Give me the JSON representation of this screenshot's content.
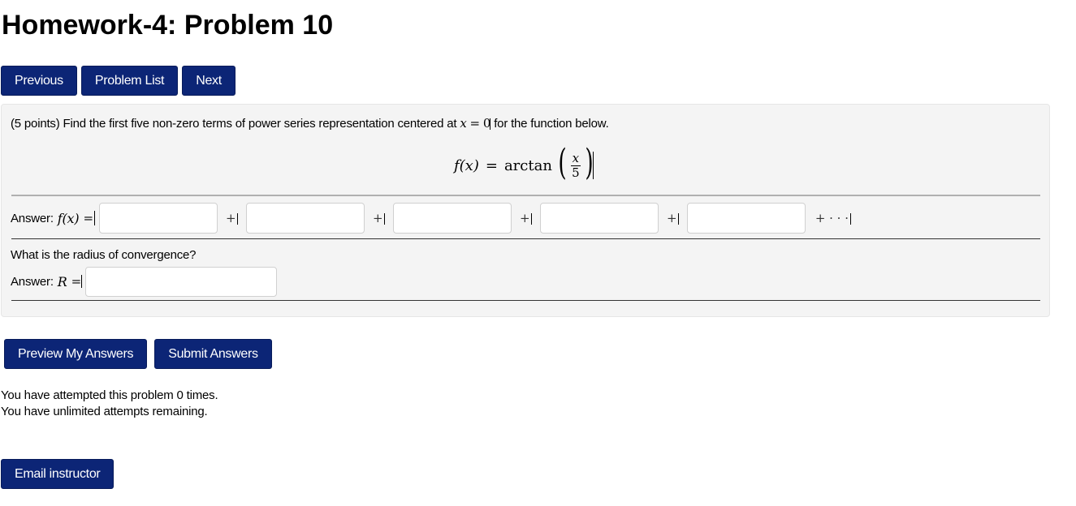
{
  "page": {
    "title": "Homework-4: Problem 10"
  },
  "nav": {
    "previous": "Previous",
    "problem_list": "Problem List",
    "next": "Next"
  },
  "problem": {
    "points": "(5 points)",
    "statement_before": "Find the first five non-zero terms of power series representation centered at",
    "center_var": "x",
    "center_eq": "=",
    "center_val": "0",
    "statement_after": "for the function below.",
    "formula": {
      "lhs": "f(x)",
      "eq": "=",
      "func": "arctan",
      "numerator": "x",
      "denominator": "5"
    },
    "answer_label": "Answer:",
    "answer_lhs": "f(x)",
    "answer_eq": "=",
    "plus": "+",
    "tail": "+ · · ·",
    "term_values": [
      "",
      "",
      "",
      "",
      ""
    ],
    "radius_question": "What is the radius of convergence?",
    "radius_label": "Answer:",
    "radius_var": "R",
    "radius_eq": "=",
    "radius_value": ""
  },
  "actions": {
    "preview": "Preview My Answers",
    "submit": "Submit Answers"
  },
  "status": {
    "attempts": "You have attempted this problem 0 times.",
    "remaining": "You have unlimited attempts remaining."
  },
  "footer": {
    "email": "Email instructor"
  },
  "colors": {
    "button_bg": "#0c2576",
    "box_bg": "#f4f4f4"
  }
}
